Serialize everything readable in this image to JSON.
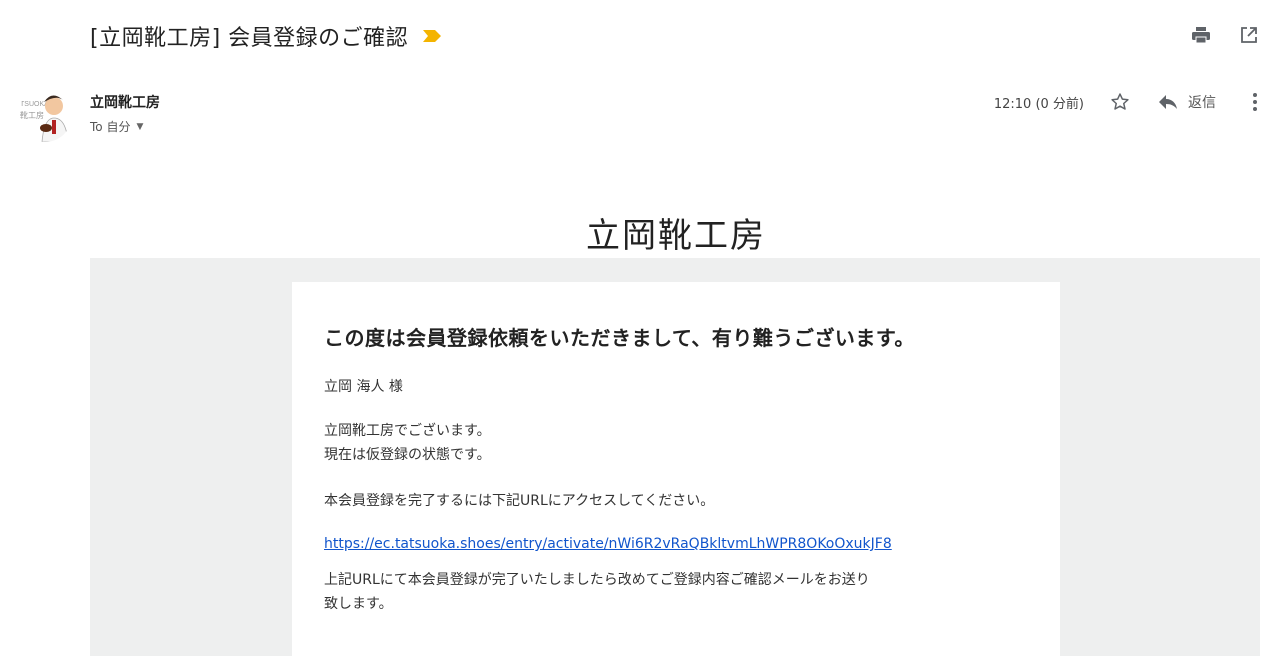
{
  "email": {
    "subject": "[立岡靴工房] 会員登録のご確認",
    "sender": "立岡靴工房",
    "to": "To 自分",
    "timestamp": "12:10 (0 分前)",
    "reply_label": "返信"
  },
  "avatar": {
    "text_line1": "TSUOKA",
    "text_line2": "靴工房"
  },
  "body": {
    "shop_title": "立岡靴工房",
    "headline": "この度は会員登録依頼をいただきまして、有り難うございます。",
    "greeting": "立岡 海人 様",
    "line1": "立岡靴工房でございます。",
    "line2": "現在は仮登録の状態です。",
    "instruction": "本会員登録を完了するには下記URLにアクセスしてください。",
    "activation_url": "https://ec.tatsuoka.shoes/entry/activate/nWi6R2vRaQBkltvmLhWPR8OKoOxukJF8",
    "closing_1": "上記URLにて本会員登録が完了いたしましたら改めてご登録内容ご確認メールをお送り",
    "closing_2": "致します。"
  },
  "colors": {
    "importance_marker": "#f4b400",
    "link": "#1155cc",
    "gray_background": "#eeefef"
  },
  "icons": [
    "print-icon",
    "open-in-new-window-icon",
    "star-icon",
    "reply-icon",
    "more-vert-icon",
    "importance-marker-icon",
    "dropdown-caret-icon"
  ]
}
